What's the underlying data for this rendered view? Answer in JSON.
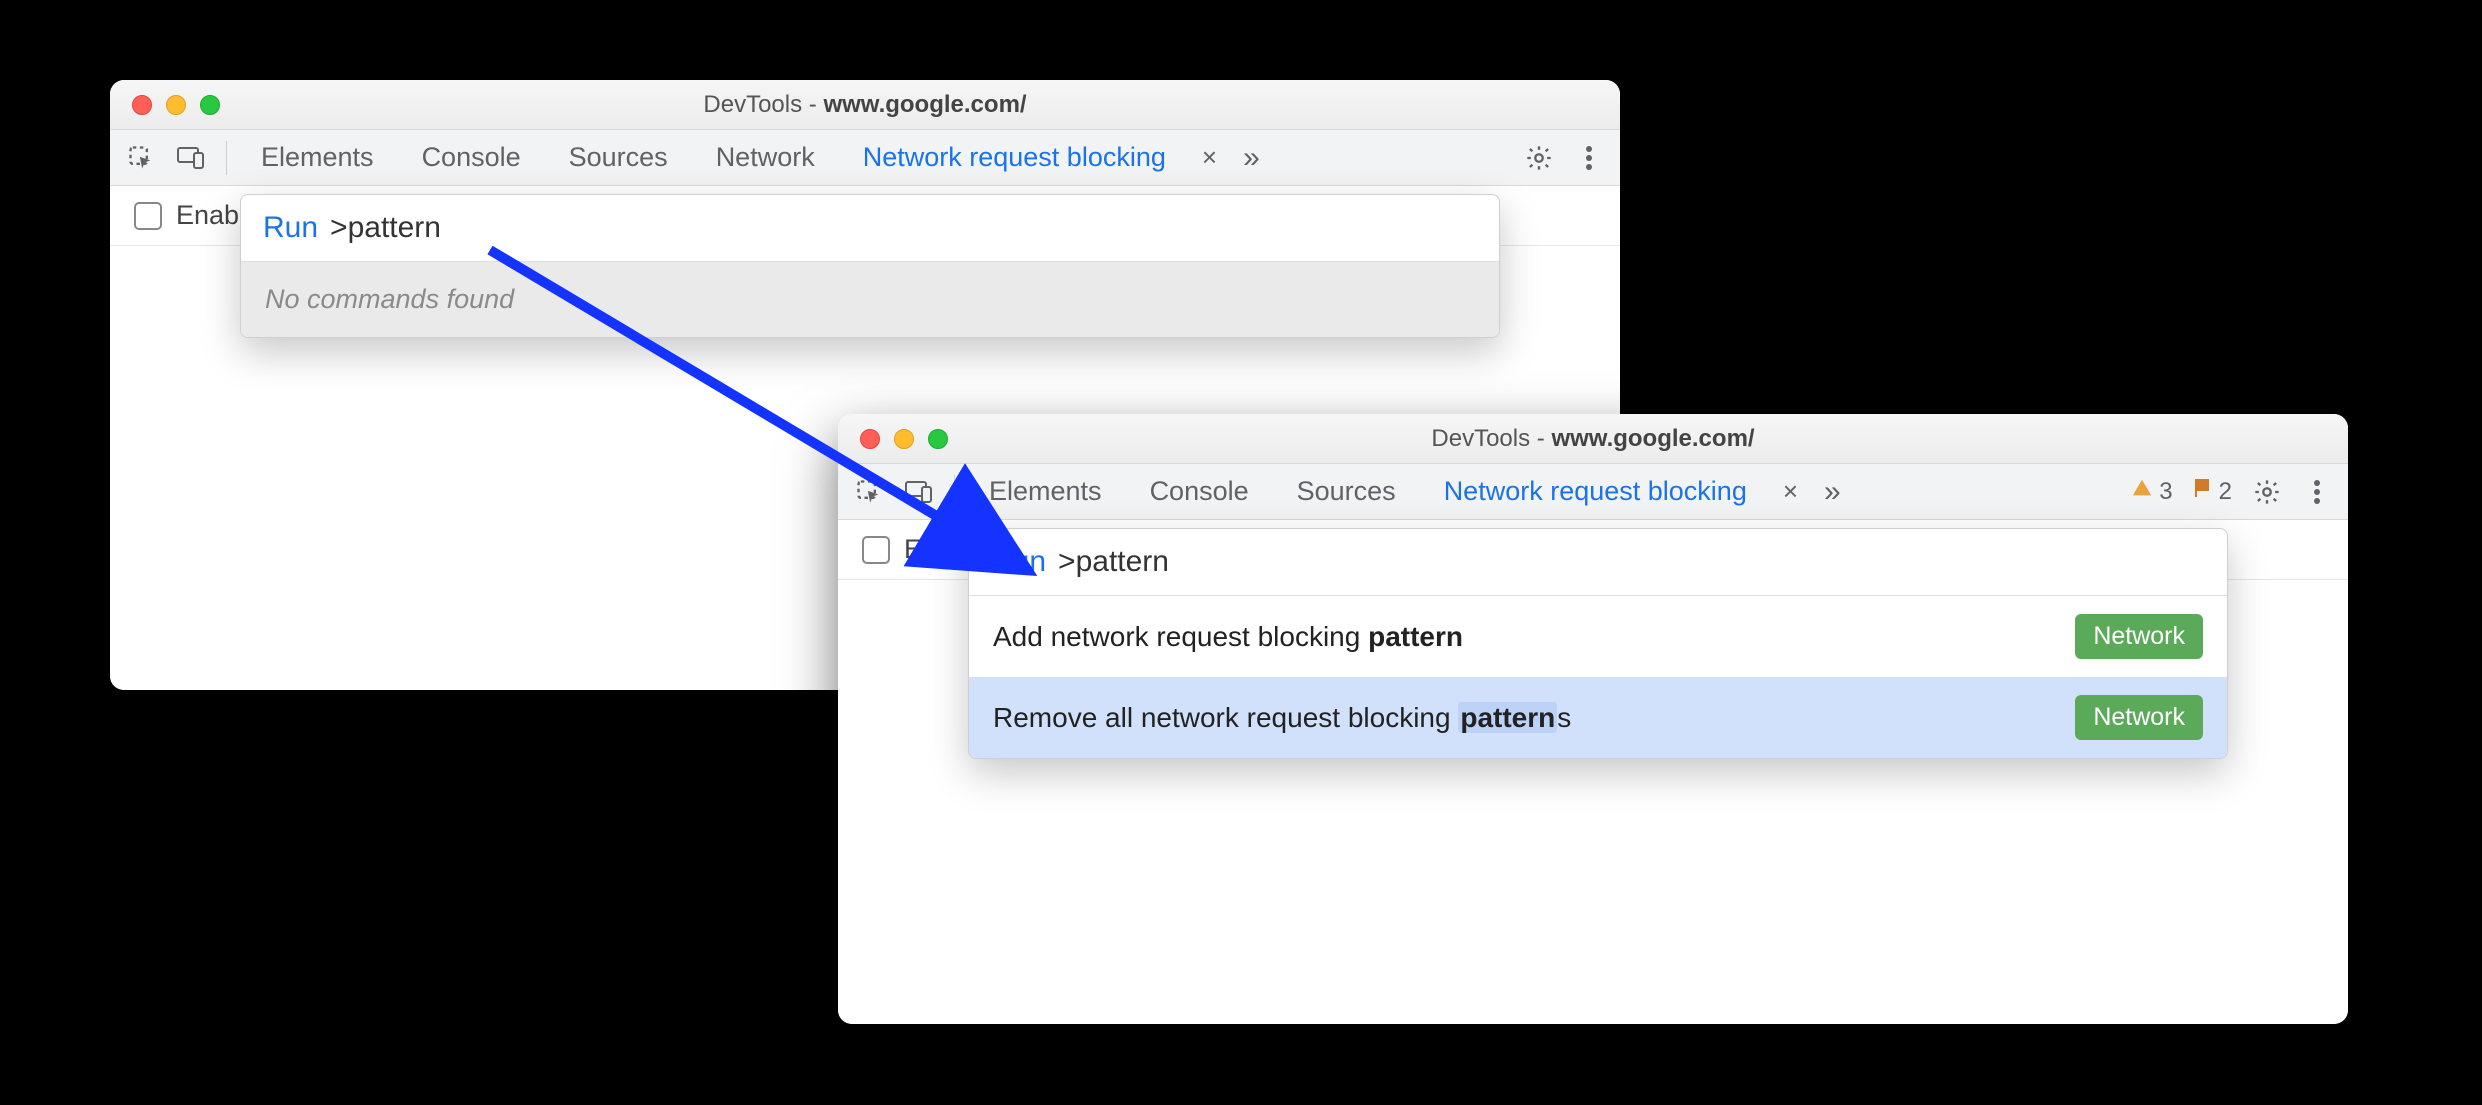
{
  "window_a": {
    "title_prefix": "DevTools - ",
    "title_host": "www.google.com/",
    "tabs": {
      "elements": "Elements",
      "console": "Console",
      "sources": "Sources",
      "network": "Network",
      "request_blocking": "Network request blocking"
    },
    "enable_label": "Enab",
    "palette": {
      "run_label": "Run",
      "gt": ">",
      "query": "pattern",
      "empty_msg": "No commands found"
    }
  },
  "window_b": {
    "title_prefix": "DevTools - ",
    "title_host": "www.google.com/",
    "tabs": {
      "elements": "Elements",
      "console": "Console",
      "sources": "Sources",
      "request_blocking": "Network request blocking"
    },
    "warnings_count": "3",
    "issues_count": "2",
    "enable_label": "Enab",
    "palette": {
      "run_label": "Run",
      "gt": ">",
      "query": "pattern",
      "items": [
        {
          "pre": "Add network request blocking ",
          "match": "pattern",
          "post": "",
          "badge": "Network",
          "selected": false
        },
        {
          "pre": "Remove all network request blocking ",
          "match": "pattern",
          "post": "s",
          "badge": "Network",
          "selected": true
        }
      ]
    }
  }
}
